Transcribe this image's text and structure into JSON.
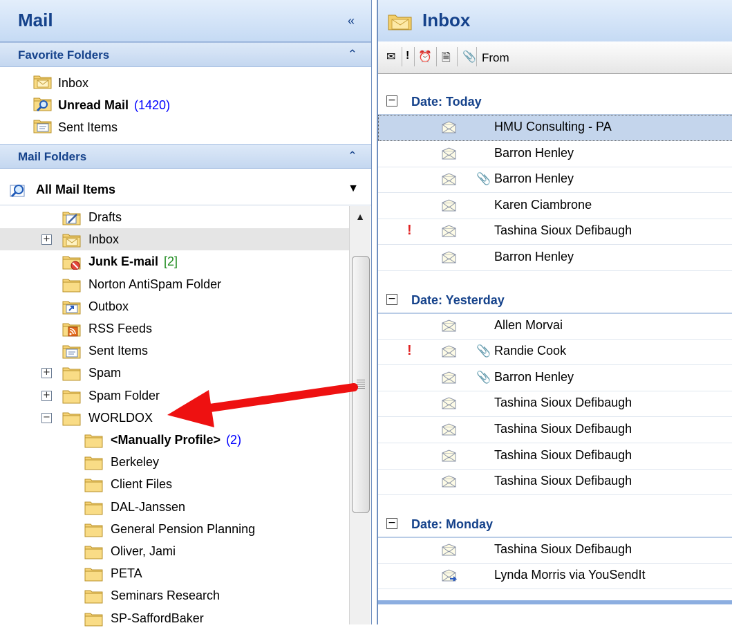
{
  "nav": {
    "title": "Mail",
    "collapse_glyph": "«",
    "favorites_header": "Favorite Folders",
    "favorites": [
      {
        "label": "Inbox",
        "icon": "inbox-folder-icon",
        "bold": false,
        "count": ""
      },
      {
        "label": "Unread Mail",
        "icon": "search-folder-icon",
        "bold": true,
        "count": "(1420)"
      },
      {
        "label": "Sent Items",
        "icon": "sent-items-icon",
        "bold": false,
        "count": ""
      }
    ],
    "mail_folders_header": "Mail Folders",
    "all_mail_items": "All Mail Items",
    "folders": [
      {
        "label": "Drafts",
        "indent": 1,
        "expander": "",
        "icon": "drafts-icon",
        "bold": false,
        "count": "",
        "selected": false
      },
      {
        "label": "Inbox",
        "indent": 1,
        "expander": "+",
        "icon": "inbox-folder-icon",
        "bold": false,
        "count": "",
        "selected": true
      },
      {
        "label": "Junk E-mail",
        "indent": 1,
        "expander": "",
        "icon": "junk-folder-icon",
        "bold": true,
        "count": "[2]",
        "selected": false
      },
      {
        "label": "Norton AntiSpam Folder",
        "indent": 1,
        "expander": "",
        "icon": "folder-icon",
        "bold": false,
        "count": "",
        "selected": false
      },
      {
        "label": "Outbox",
        "indent": 1,
        "expander": "",
        "icon": "outbox-icon",
        "bold": false,
        "count": "",
        "selected": false
      },
      {
        "label": "RSS Feeds",
        "indent": 1,
        "expander": "",
        "icon": "rss-folder-icon",
        "bold": false,
        "count": "",
        "selected": false
      },
      {
        "label": "Sent Items",
        "indent": 1,
        "expander": "",
        "icon": "sent-items-icon",
        "bold": false,
        "count": "",
        "selected": false
      },
      {
        "label": "Spam",
        "indent": 1,
        "expander": "+",
        "icon": "folder-icon",
        "bold": false,
        "count": "",
        "selected": false
      },
      {
        "label": "Spam Folder",
        "indent": 1,
        "expander": "+",
        "icon": "folder-icon",
        "bold": false,
        "count": "",
        "selected": false
      },
      {
        "label": "WORLDOX",
        "indent": 1,
        "expander": "-",
        "icon": "folder-icon",
        "bold": false,
        "count": "",
        "selected": false
      },
      {
        "label": "<Manually Profile>",
        "indent": 2,
        "expander": "",
        "icon": "folder-icon",
        "bold": true,
        "count": "(2)",
        "selected": false
      },
      {
        "label": "Berkeley",
        "indent": 2,
        "expander": "",
        "icon": "folder-icon",
        "bold": false,
        "count": "",
        "selected": false
      },
      {
        "label": "Client Files",
        "indent": 2,
        "expander": "",
        "icon": "folder-icon",
        "bold": false,
        "count": "",
        "selected": false
      },
      {
        "label": "DAL-Janssen",
        "indent": 2,
        "expander": "",
        "icon": "folder-icon",
        "bold": false,
        "count": "",
        "selected": false
      },
      {
        "label": "General Pension Planning",
        "indent": 2,
        "expander": "",
        "icon": "folder-icon",
        "bold": false,
        "count": "",
        "selected": false
      },
      {
        "label": "Oliver, Jami",
        "indent": 2,
        "expander": "",
        "icon": "folder-icon",
        "bold": false,
        "count": "",
        "selected": false
      },
      {
        "label": "PETA",
        "indent": 2,
        "expander": "",
        "icon": "folder-icon",
        "bold": false,
        "count": "",
        "selected": false
      },
      {
        "label": "Seminars Research",
        "indent": 2,
        "expander": "",
        "icon": "folder-icon",
        "bold": false,
        "count": "",
        "selected": false
      },
      {
        "label": "SP-SaffordBaker",
        "indent": 2,
        "expander": "",
        "icon": "folder-icon",
        "bold": false,
        "count": "",
        "selected": false
      }
    ]
  },
  "inbox": {
    "title": "Inbox",
    "column_from": "From",
    "groups": [
      {
        "label": "Date: Today",
        "messages": [
          {
            "sender": "HMU Consulting - PA",
            "important": false,
            "attachment": false,
            "selected": true
          },
          {
            "sender": "Barron Henley",
            "important": false,
            "attachment": false,
            "selected": false
          },
          {
            "sender": "Barron Henley",
            "important": false,
            "attachment": true,
            "selected": false
          },
          {
            "sender": "Karen Ciambrone",
            "important": false,
            "attachment": false,
            "selected": false
          },
          {
            "sender": "Tashina Sioux Defibaugh",
            "important": true,
            "attachment": false,
            "selected": false
          },
          {
            "sender": "Barron Henley",
            "important": false,
            "attachment": false,
            "selected": false
          }
        ]
      },
      {
        "label": "Date: Yesterday",
        "messages": [
          {
            "sender": "Allen Morvai",
            "important": false,
            "attachment": false,
            "selected": false
          },
          {
            "sender": "Randie Cook",
            "important": true,
            "attachment": true,
            "selected": false
          },
          {
            "sender": "Barron Henley",
            "important": false,
            "attachment": true,
            "selected": false
          },
          {
            "sender": "Tashina Sioux Defibaugh",
            "important": false,
            "attachment": false,
            "selected": false
          },
          {
            "sender": "Tashina Sioux Defibaugh",
            "important": false,
            "attachment": false,
            "selected": false
          },
          {
            "sender": "Tashina Sioux Defibaugh",
            "important": false,
            "attachment": false,
            "selected": false
          },
          {
            "sender": "Tashina Sioux Defibaugh",
            "important": false,
            "attachment": false,
            "selected": false
          }
        ]
      },
      {
        "label": "Date: Monday",
        "messages": [
          {
            "sender": "Tashina Sioux Defibaugh",
            "important": false,
            "attachment": false,
            "selected": false
          },
          {
            "sender": "Lynda Morris via YouSendIt",
            "important": false,
            "attachment": false,
            "selected": false
          }
        ]
      }
    ]
  },
  "colors": {
    "header_text": "#15428b",
    "arrow": "#ee1111",
    "unread_count": "#0000ff",
    "junk_count": "#1c8a1c"
  }
}
